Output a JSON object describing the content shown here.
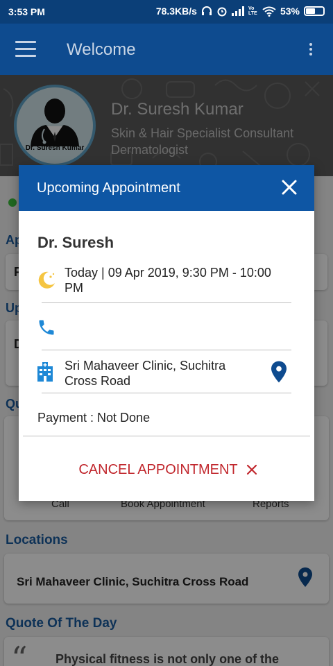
{
  "status_bar": {
    "time": "3:53 PM",
    "network_speed": "78.3KB/s",
    "lte": "Vo LTE",
    "battery_percent": "53%",
    "battery_level": 0.53
  },
  "app_bar": {
    "title": "Welcome",
    "menu_icon": "hamburger-menu-icon",
    "overflow_icon": "more-vert-icon"
  },
  "profile": {
    "name": "Dr. Suresh Kumar",
    "avatar_caption": "Dr. Suresh Kumar",
    "specialty_line1": "Skin & Hair Specialist Consultant",
    "specialty_line2": "Dermatologist"
  },
  "background": {
    "frag_ap": "Ap",
    "frag_f": "F",
    "frag_up": "Up",
    "frag_d": "D",
    "frag_qu": "Qu",
    "quick_actions": [
      "Call",
      "Book Appointment",
      "Reports"
    ],
    "locations_title": "Locations",
    "location_name": "Sri Mahaveer Clinic, Suchitra Cross Road",
    "quote_title": "Quote Of The Day",
    "quote_text": "Physical fitness is not only one of the"
  },
  "dialog": {
    "title": "Upcoming Appointment",
    "doctor": "Dr. Suresh",
    "datetime_line1": "Today | 09 Apr 2019, 9:30 PM - 10:00",
    "datetime_line2": "PM",
    "clinic_line1": "Sri Mahaveer Clinic, Suchitra",
    "clinic_line2": "Cross Road",
    "payment": "Payment : Not Done",
    "cancel_label": "CANCEL APPOINTMENT"
  },
  "colors": {
    "primary": "#0e4b8f",
    "dialog_header": "#0e56a4",
    "cancel": "#c1272d",
    "moon": "#f5c542",
    "pin": "#0e4b8f"
  }
}
